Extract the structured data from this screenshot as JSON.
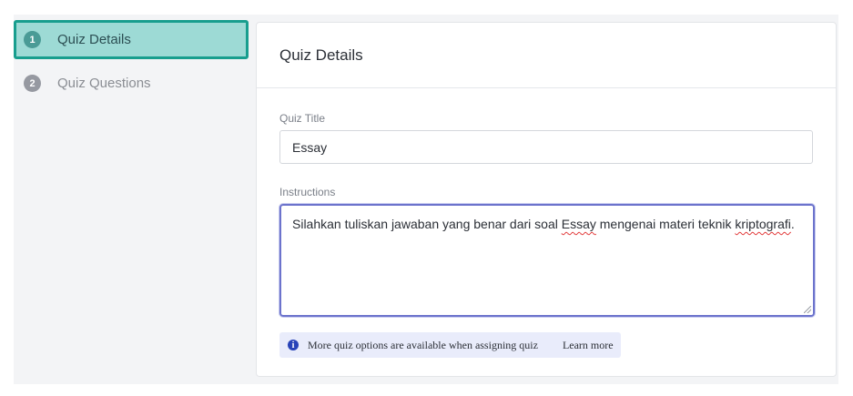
{
  "sidebar": {
    "steps": [
      {
        "number": "1",
        "label": "Quiz Details"
      },
      {
        "number": "2",
        "label": "Quiz Questions"
      }
    ]
  },
  "card": {
    "title": "Quiz Details"
  },
  "form": {
    "quiz_title_label": "Quiz Title",
    "quiz_title_value": "Essay",
    "instructions_label": "Instructions",
    "instructions_part1": "Silahkan tuliskan jawaban yang benar dari soal ",
    "instructions_misspelled1": "Essay",
    "instructions_part2": " mengenai materi teknik ",
    "instructions_misspelled2": "kriptografi",
    "instructions_part3": "."
  },
  "info": {
    "icon": "info-icon",
    "text": "More quiz options are available when assigning quiz",
    "link": "Learn more"
  },
  "colors": {
    "active_step_bg": "#9ddad5",
    "active_step_border": "#189e8e",
    "focus_border": "#6c73cc",
    "info_bg": "#e9ecfb",
    "info_icon": "#2843b8"
  }
}
